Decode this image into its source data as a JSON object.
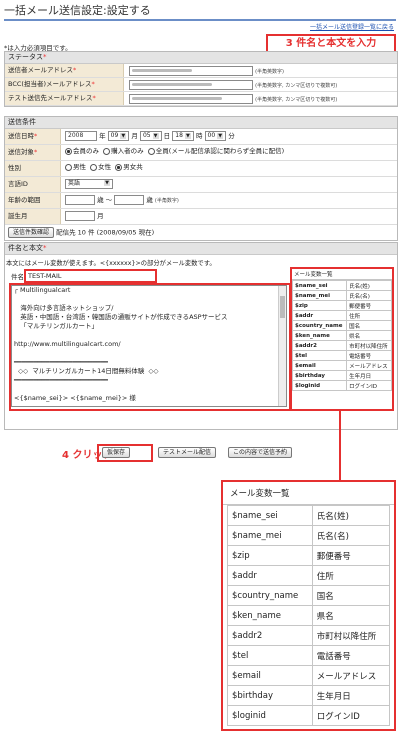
{
  "page": {
    "title": "一括メール送信設定:設定する",
    "back_link": "一括メール送信登録一覧に戻る",
    "required_note": "*は入力必須項目です。",
    "step3_label": "3 件名と本文を入力",
    "step4_label": "4 クリック"
  },
  "section1": {
    "status_label": "ステータス",
    "sender_label": "送信者メールアドレス",
    "sender_hint": "(半角英数字)",
    "bcc_label": "BCC(担当者)メールアドレス",
    "bcc_hint": "(半角英数字, カンマ区切りで複数可)",
    "test_label": "テスト送信先メールアドレス",
    "test_hint": "(半角英数字, カンマ区切りで複数可)"
  },
  "conditions": {
    "heading": "送信条件",
    "datetime_label": "送信日時",
    "year": "2008",
    "year_unit": "年",
    "month": "09",
    "month_unit": "月",
    "day": "05",
    "day_unit": "日",
    "hour": "18",
    "hour_unit": "時",
    "minute": "00",
    "minute_unit": "分",
    "target_label": "送信対象",
    "target_opt1": "会員のみ",
    "target_opt2": "購入者のみ",
    "target_opt3": "全員(メール配信承認に関わらず全員に配信)",
    "gender_label": "性別",
    "gender_opt1": "男性",
    "gender_opt2": "女性",
    "gender_opt3": "男女共",
    "lang_label": "言語ID",
    "lang_value": "英語",
    "age_label": "年齢の範囲",
    "age_unit_from": "歳 〜",
    "age_unit_to": "歳",
    "age_hint": "(半角数字)",
    "birth_label": "誕生月",
    "birth_unit": "月",
    "check_button": "送信件数確認",
    "count_text": "配信先 10 件 (2008/09/05 現在)"
  },
  "body": {
    "heading": "件名と本文",
    "note": "本文にはメール変数が使えます。<{xxxxxx}>の部分がメール変数です。",
    "subject_label": "件名",
    "subject_value": "TEST-MAIL",
    "lines": [
      "┌ Multilingualcart",
      "",
      "   海外向け多言語ネットショップ/",
      "   英語・中国語・台湾語・韓国語の通販サイトが作成できるASPサービス",
      "   「マルチリンガルカート」",
      "",
      "http://www.multilingualcart.com/",
      "",
      "━━━━━━━━━━━━━━━━━━━━━━━━",
      "  ◇◇  マルチリンガルカート14日間無料体験  ◇◇",
      "━━━━━━━━━━━━━━━━━━━━━━━━",
      "",
      "<{$name_sei}> <{$name_mei}> 様"
    ]
  },
  "variables": {
    "heading": "メール変数一覧",
    "rows": [
      {
        "key": "$name_sei",
        "label": "氏名(姓)"
      },
      {
        "key": "$name_mei",
        "label": "氏名(名)"
      },
      {
        "key": "$zip",
        "label": "郵便番号"
      },
      {
        "key": "$addr",
        "label": "住所"
      },
      {
        "key": "$country_name",
        "label": "国名"
      },
      {
        "key": "$ken_name",
        "label": "県名"
      },
      {
        "key": "$addr2",
        "label": "市町村以降住所"
      },
      {
        "key": "$tel",
        "label": "電話番号"
      },
      {
        "key": "$email",
        "label": "メールアドレス"
      },
      {
        "key": "$birthday",
        "label": "生年月日"
      },
      {
        "key": "$loginid",
        "label": "ログインID"
      }
    ]
  },
  "buttons": {
    "save": "仮保存",
    "test": "テストメール配信",
    "schedule": "この内容で送信予約"
  },
  "colors": {
    "accent_red": "#e53030",
    "header_blue": "#6b8ec7",
    "label_bg": "#f3ead6"
  }
}
